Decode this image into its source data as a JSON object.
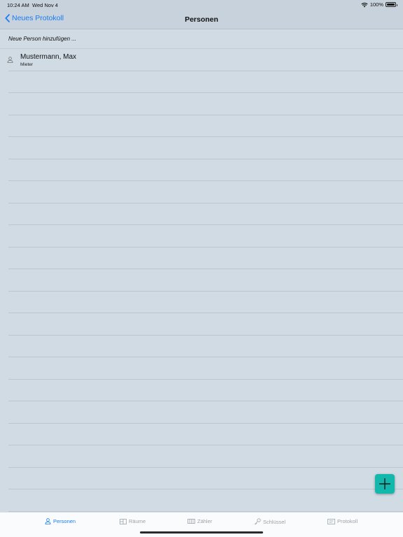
{
  "status": {
    "time": "10:24 AM",
    "date": "Wed Nov 4",
    "battery": "100%"
  },
  "nav": {
    "back_label": "Neues Protokoll",
    "title": "Personen"
  },
  "list": {
    "add_label": "Neue Person hinzufügen ...",
    "persons": [
      {
        "name": "Mustermann, Max",
        "role": "Mieter"
      }
    ]
  },
  "tabs": [
    {
      "label": "Personen",
      "icon": "person-icon",
      "active": true
    },
    {
      "label": "Räume",
      "icon": "rooms-icon",
      "active": false
    },
    {
      "label": "Zähler",
      "icon": "meter-icon",
      "active": false
    },
    {
      "label": "Schlüssel",
      "icon": "key-icon",
      "active": false
    },
    {
      "label": "Protokoll",
      "icon": "protocol-icon",
      "active": false
    }
  ],
  "colors": {
    "accent": "#1a7cf2",
    "fab": "#13b8ad",
    "background": "#d0dbe4"
  }
}
